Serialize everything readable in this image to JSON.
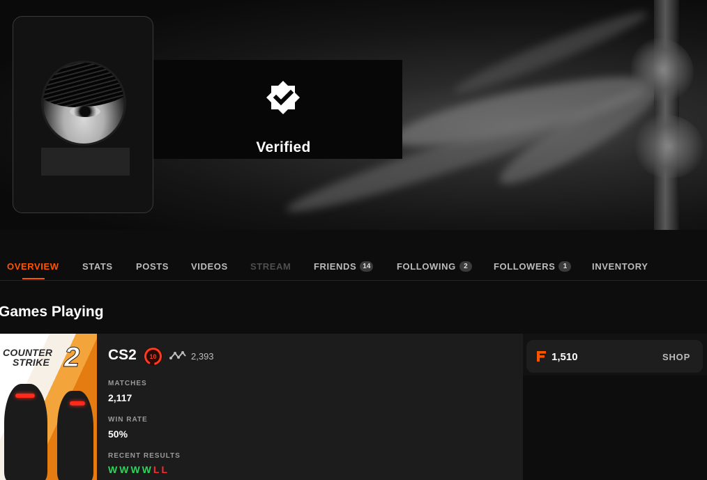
{
  "profile": {
    "verified_label": "Verified"
  },
  "tabs": [
    {
      "label": "OVERVIEW"
    },
    {
      "label": "STATS"
    },
    {
      "label": "POSTS"
    },
    {
      "label": "VIDEOS"
    },
    {
      "label": "STREAM"
    },
    {
      "label": "FRIENDS",
      "count": "14"
    },
    {
      "label": "FOLLOWING",
      "count": "2"
    },
    {
      "label": "FOLLOWERS",
      "count": "1"
    },
    {
      "label": "INVENTORY"
    }
  ],
  "active_tab": "OVERVIEW",
  "section_title": "Games Playing",
  "game": {
    "cover_logo_line1": "COUNTER",
    "cover_logo_line2": "STRIKE",
    "cover_logo_number": "2",
    "name": "CS2",
    "level": "10",
    "elo": "2,393",
    "matches_label": "MATCHES",
    "matches_value": "2,117",
    "winrate_label": "WIN RATE",
    "winrate_value": "50%",
    "recent_label": "RECENT RESULTS",
    "recent_results": [
      "W",
      "W",
      "W",
      "W",
      "L",
      "L"
    ]
  },
  "points": {
    "value": "1,510",
    "shop_label": "SHOP"
  },
  "colors": {
    "accent": "#ff5500",
    "win": "#2fd45a",
    "loss": "#ff2a2a",
    "level_ring": "#ff3b1f"
  }
}
